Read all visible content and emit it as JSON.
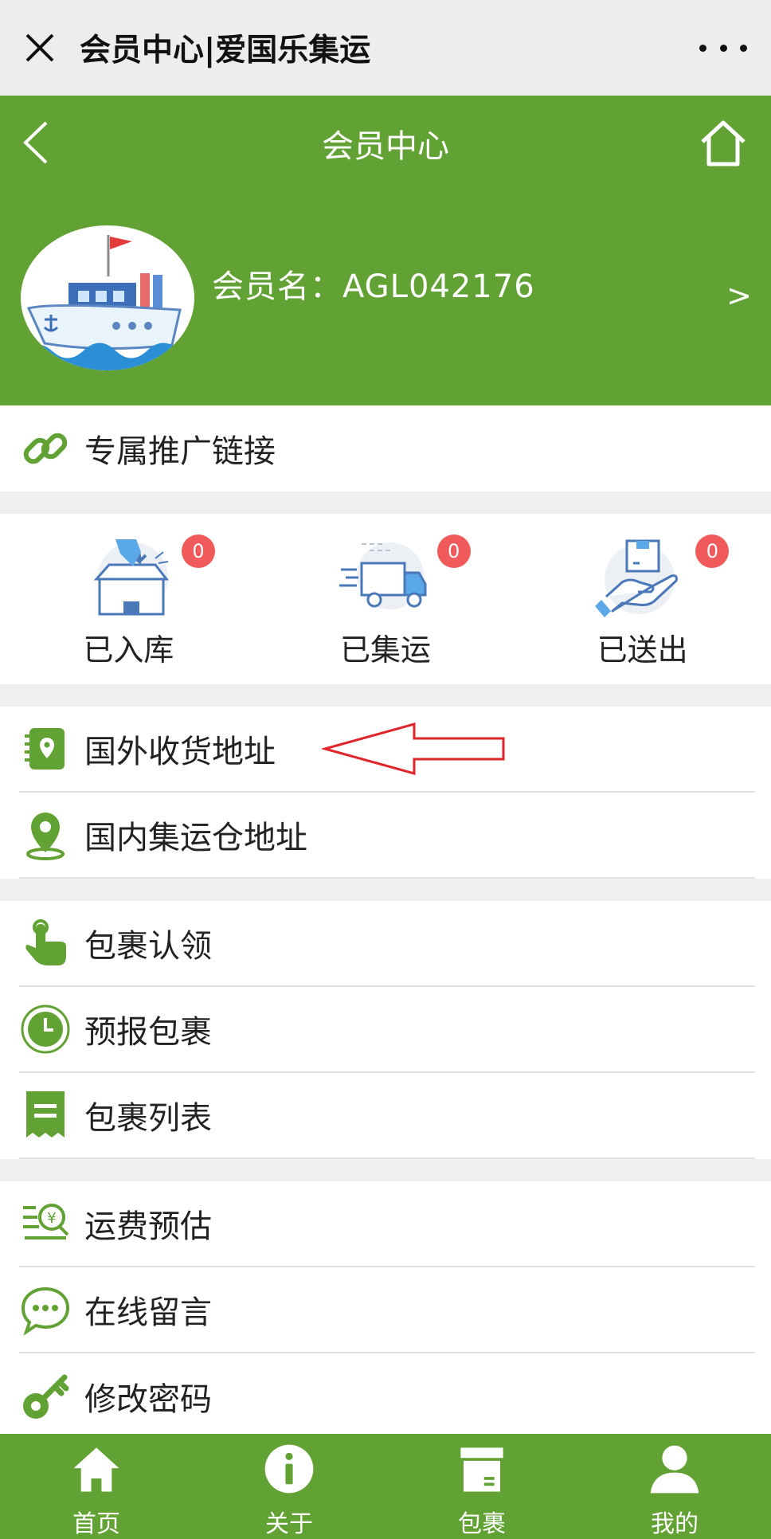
{
  "wechat_bar": {
    "title": "会员中心|爱国乐集运"
  },
  "nav": {
    "title": "会员中心"
  },
  "profile": {
    "member_label": "会员名：",
    "member_name": "AGL042176",
    "arrow": ">"
  },
  "promo": {
    "label": "专属推广链接"
  },
  "stats": [
    {
      "label": "已入库",
      "count": "0"
    },
    {
      "label": "已集运",
      "count": "0"
    },
    {
      "label": "已送出",
      "count": "0"
    }
  ],
  "address_menu": [
    {
      "label": "国外收货地址",
      "icon": "address-book-icon"
    },
    {
      "label": "国内集运仓地址",
      "icon": "location-pin-icon"
    }
  ],
  "parcel_menu": [
    {
      "label": "包裹认领",
      "icon": "tap-hand-icon"
    },
    {
      "label": "预报包裹",
      "icon": "clock-icon"
    },
    {
      "label": "包裹列表",
      "icon": "receipt-list-icon"
    }
  ],
  "tool_menu": [
    {
      "label": "运费预估",
      "icon": "price-search-icon"
    },
    {
      "label": "在线留言",
      "icon": "chat-bubble-icon"
    },
    {
      "label": "修改密码",
      "icon": "key-icon"
    }
  ],
  "tabbar": [
    {
      "label": "首页",
      "icon": "home-icon"
    },
    {
      "label": "关于",
      "icon": "info-icon"
    },
    {
      "label": "包裹",
      "icon": "package-icon"
    },
    {
      "label": "我的",
      "icon": "user-icon"
    }
  ],
  "colors": {
    "brand_green": "#62a133",
    "badge_red": "#f05a5a",
    "annotation_red": "#e0262b"
  }
}
